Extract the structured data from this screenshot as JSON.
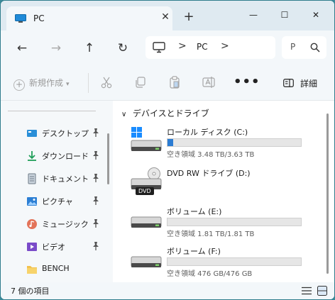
{
  "tab": {
    "title": "PC"
  },
  "window": {
    "close_tab_glyph": "✕",
    "new_tab_glyph": "+",
    "minimize_glyph": "—",
    "maximize_glyph": "☐",
    "close_glyph": "✕"
  },
  "nav": {
    "back_glyph": "←",
    "forward_glyph": "→",
    "up_glyph": "↑",
    "refresh_glyph": "↻"
  },
  "address": {
    "location": "PC",
    "separator": ">"
  },
  "search": {
    "placeholder": "P"
  },
  "toolbar": {
    "new_label": "新規作成",
    "more_label": "•••",
    "details_label": "詳細"
  },
  "sidebar": {
    "items": [
      {
        "label": "デスクトップ",
        "icon": "desktop-icon",
        "pinned": true
      },
      {
        "label": "ダウンロード",
        "icon": "download-icon",
        "pinned": true
      },
      {
        "label": "ドキュメント",
        "icon": "documents-icon",
        "pinned": true
      },
      {
        "label": "ピクチャ",
        "icon": "pictures-icon",
        "pinned": true
      },
      {
        "label": "ミュージック",
        "icon": "music-icon",
        "pinned": true
      },
      {
        "label": "ビデオ",
        "icon": "videos-icon",
        "pinned": true
      },
      {
        "label": "BENCH",
        "icon": "folder-icon",
        "pinned": false
      }
    ]
  },
  "content": {
    "group_label": "デバイスとドライブ",
    "drives": [
      {
        "name": "ローカル ディスク (C:)",
        "free_text": "空き領域 3.48 TB/3.63 TB",
        "used_fraction": 0.04,
        "type": "system"
      },
      {
        "name": "DVD RW ドライブ (D:)",
        "badge": "DVD",
        "type": "dvd"
      },
      {
        "name": "ボリューム (E:)",
        "free_text": "空き領域 1.81 TB/1.81 TB",
        "used_fraction": 0.0,
        "type": "hdd"
      },
      {
        "name": "ボリューム (F:)",
        "free_text": "空き領域 476 GB/476 GB",
        "used_fraction": 0.0,
        "type": "hdd"
      }
    ]
  },
  "status": {
    "item_count": "7 個の項目"
  },
  "colors": {
    "accent": "#2b7cd3",
    "titlebar": "#dfeaf1",
    "frame": "#3a8a9a"
  }
}
